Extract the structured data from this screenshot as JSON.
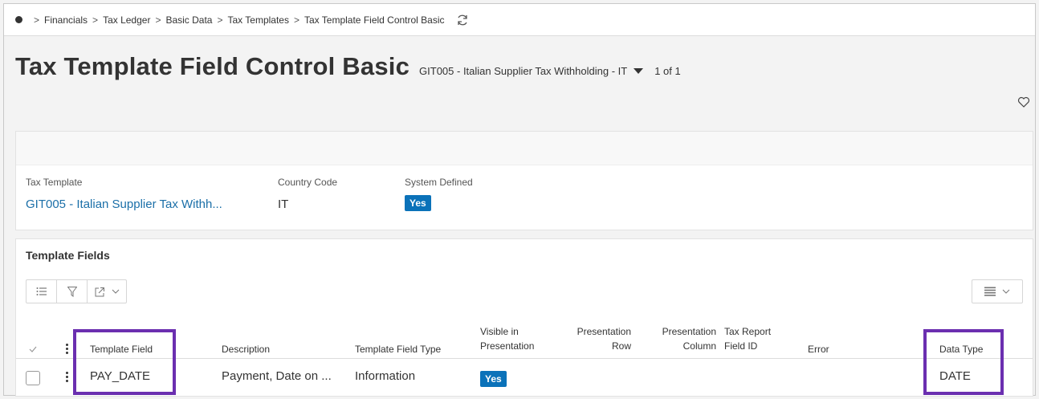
{
  "breadcrumb": {
    "items": [
      "Financials",
      "Tax Ledger",
      "Basic Data",
      "Tax Templates",
      "Tax Template Field Control Basic"
    ]
  },
  "header": {
    "title": "Tax Template Field Control Basic",
    "record_selector": "GIT005 - Italian Supplier Tax Withholding - IT",
    "record_count": "1 of 1"
  },
  "details": {
    "tax_template_label": "Tax Template",
    "tax_template_value": "GIT005 - Italian Supplier Tax Withh...",
    "country_code_label": "Country Code",
    "country_code_value": "IT",
    "system_defined_label": "System Defined",
    "system_defined_value": "Yes"
  },
  "template_fields": {
    "title": "Template Fields",
    "columns": {
      "template_field": "Template Field",
      "description": "Description",
      "template_field_type": "Template Field Type",
      "visible_line1": "Visible in",
      "visible_line2": "Presentation",
      "pres_row_line1": "Presentation",
      "pres_row_line2": "Row",
      "pres_col_line1": "Presentation",
      "pres_col_line2": "Column",
      "tax_report_line1": "Tax Report",
      "tax_report_line2": "Field ID",
      "error": "Error",
      "data_type": "Data Type"
    },
    "rows": [
      {
        "template_field": "PAY_DATE",
        "description": "Payment, Date on ...",
        "template_field_type": "Information",
        "visible_in_presentation": "Yes",
        "data_type": "DATE"
      }
    ]
  },
  "colors": {
    "accent": "#0b72b9",
    "link": "#1b6fa8",
    "highlight": "#6b2fb0"
  },
  "icons": [
    "refresh-icon",
    "favorite-heart-icon",
    "list-icon",
    "filter-icon",
    "export-icon",
    "column-settings-icon",
    "chevron-down-icon",
    "kebab-icon",
    "check-icon"
  ]
}
